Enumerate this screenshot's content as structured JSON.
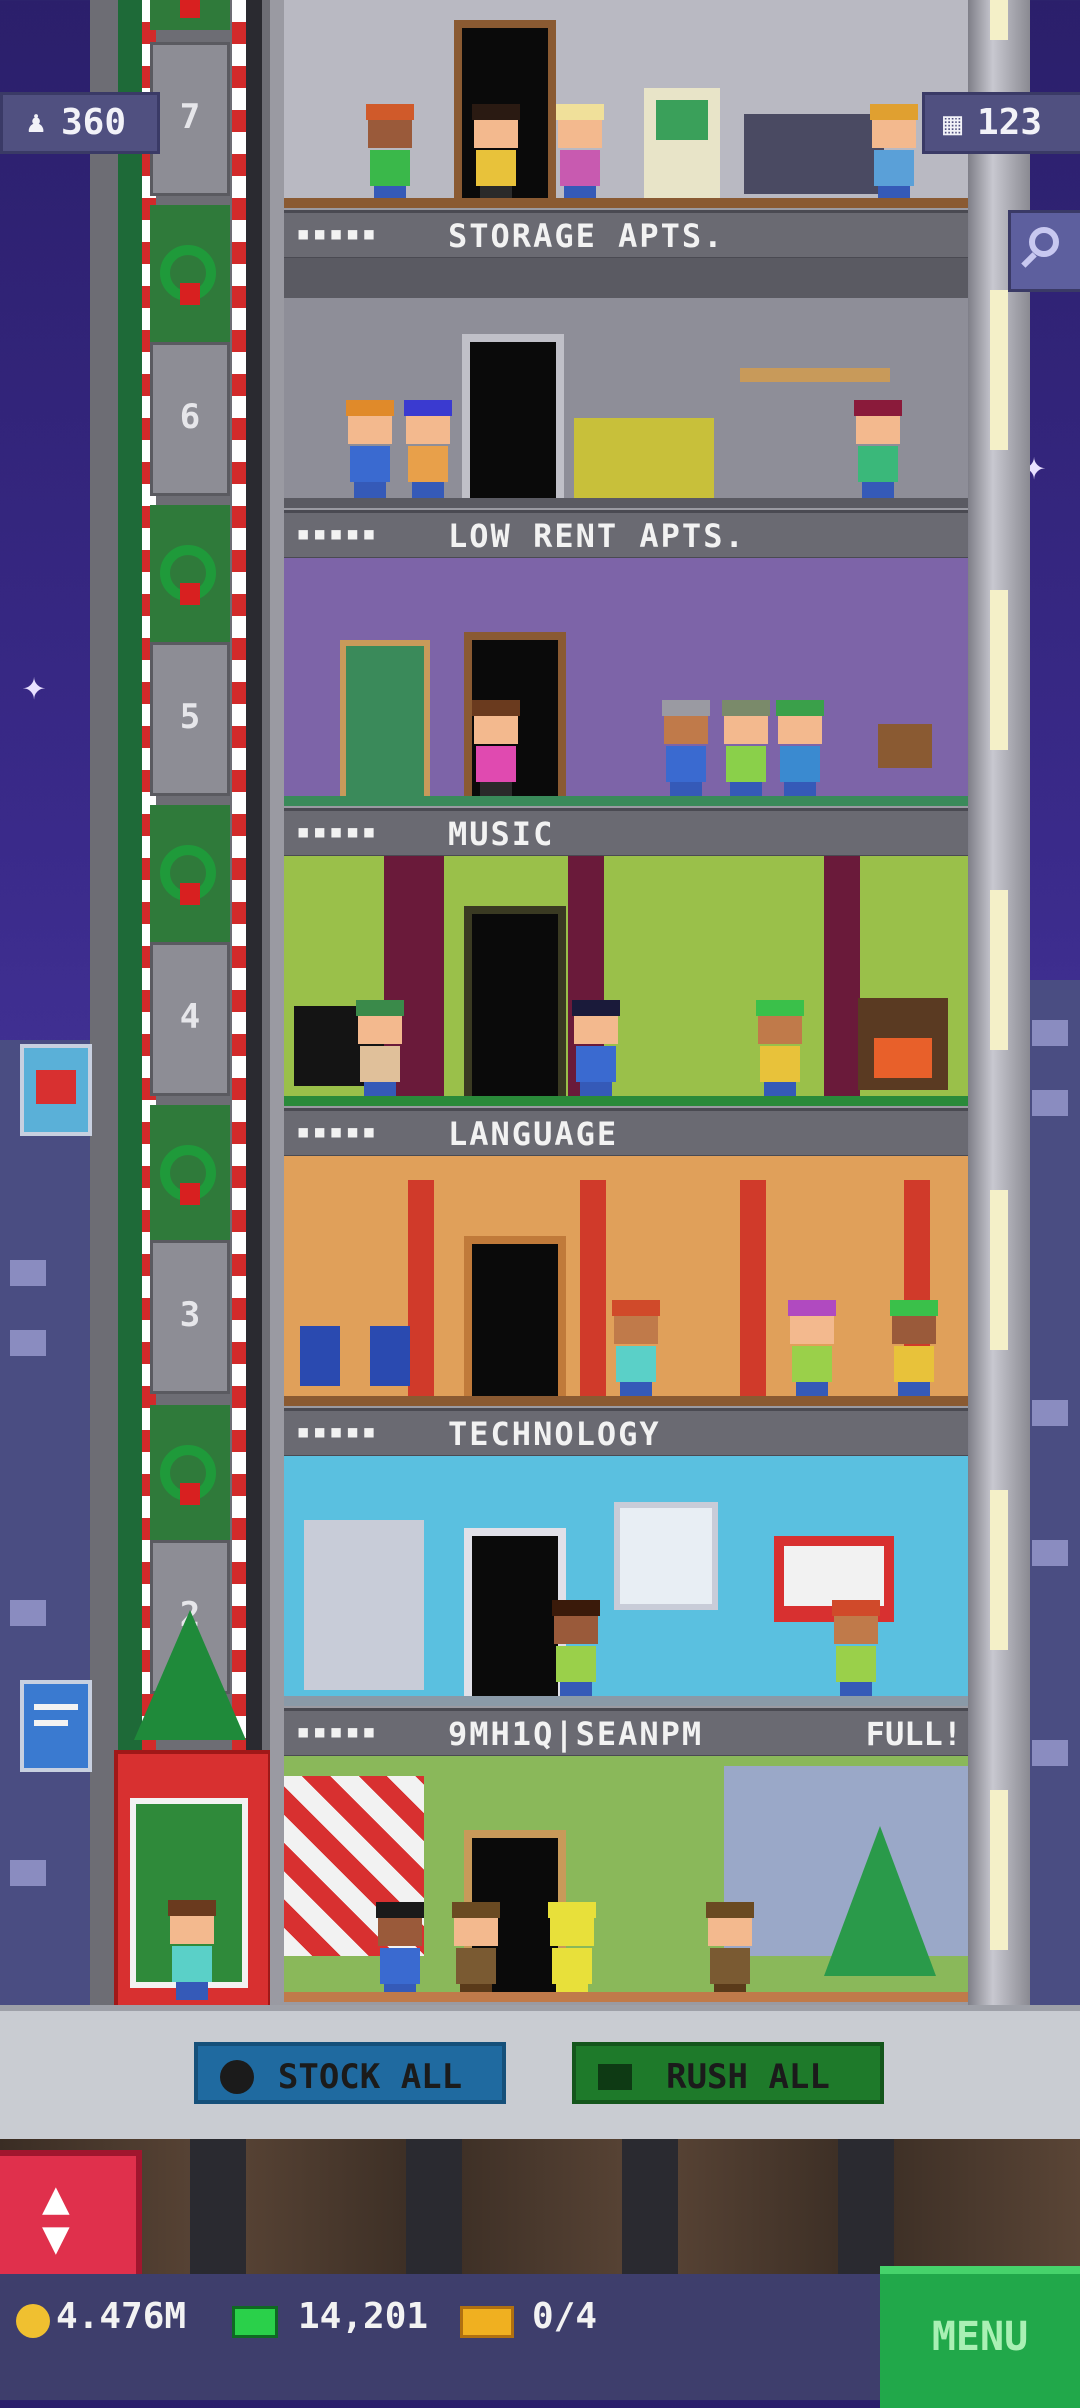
{
  "hud": {
    "population": "360",
    "floors_count": "123",
    "coins": "4.476M",
    "bux": "14,201",
    "tickets": "0/4",
    "menu_label": "MENU"
  },
  "actions": {
    "stock_all": "STOCK ALL",
    "rush_all": "RUSH ALL"
  },
  "elevator": {
    "floor_numbers": [
      "7",
      "6",
      "5",
      "4",
      "3",
      "2"
    ]
  },
  "floors": [
    {
      "name": "STORAGE APTS.",
      "stars": "▪▪▪▪▪"
    },
    {
      "name": "LOW RENT APTS.",
      "stars": "▪▪▪▪▪"
    },
    {
      "name": "MUSIC",
      "stars": "▪▪▪▪▪"
    },
    {
      "name": "LANGUAGE",
      "stars": "▪▪▪▪▪"
    },
    {
      "name": "TECHNOLOGY",
      "stars": "▪▪▪▪▪"
    },
    {
      "name": "9MH1Q|SEANPM",
      "stars": "▪▪▪▪▪",
      "status": "FULL!"
    }
  ],
  "icons": [
    "population-icon",
    "floors-icon",
    "search-icon",
    "coin-icon",
    "bux-icon",
    "ticket-icon",
    "clock-icon",
    "rush-icon",
    "elevator-updown-icon",
    "wreath-icon",
    "christmas-tree-icon"
  ],
  "colors": {
    "sky": "#3a2a8a",
    "stock_button": "#1f6aa0",
    "rush_button": "#1e7a2a",
    "menu_button": "#21a84a",
    "elevator_button": "#e0304c"
  }
}
